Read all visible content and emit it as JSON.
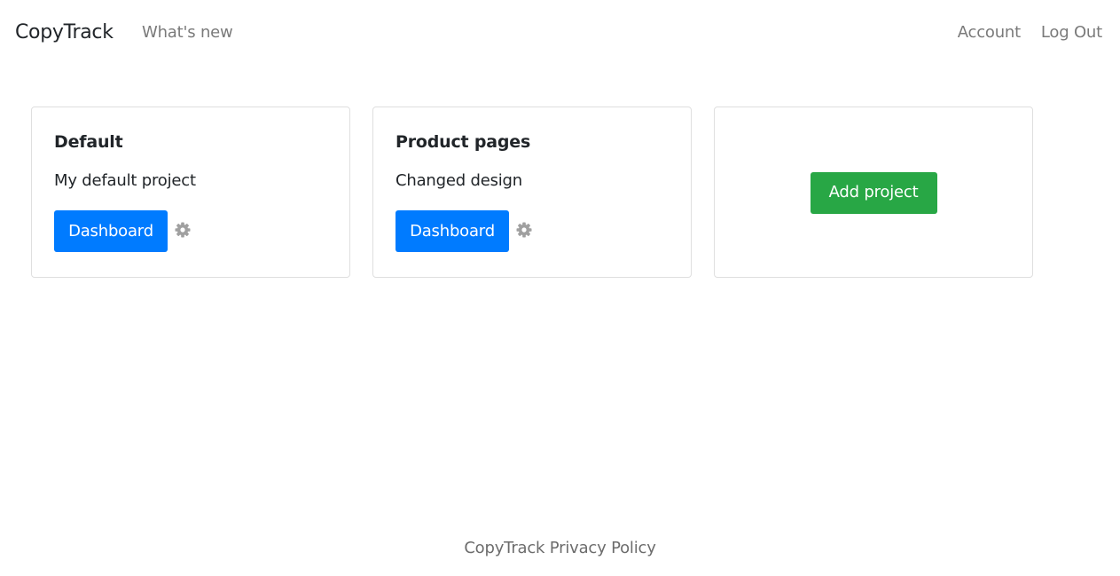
{
  "navbar": {
    "brand": "CopyTrack",
    "whats_new": "What's new",
    "account": "Account",
    "logout": "Log Out"
  },
  "projects": [
    {
      "title": "Default",
      "description": "My default project",
      "dashboard_label": "Dashboard",
      "settings_icon": "gear-icon"
    },
    {
      "title": "Product pages",
      "description": "Changed design",
      "dashboard_label": "Dashboard",
      "settings_icon": "gear-icon"
    }
  ],
  "add_project": {
    "label": "Add project"
  },
  "footer": {
    "privacy_link": "CopyTrack Privacy Policy"
  },
  "colors": {
    "primary": "#007bff",
    "success": "#28a745",
    "muted_link": "#7a7a7a",
    "gear": "#a0a0a0"
  }
}
